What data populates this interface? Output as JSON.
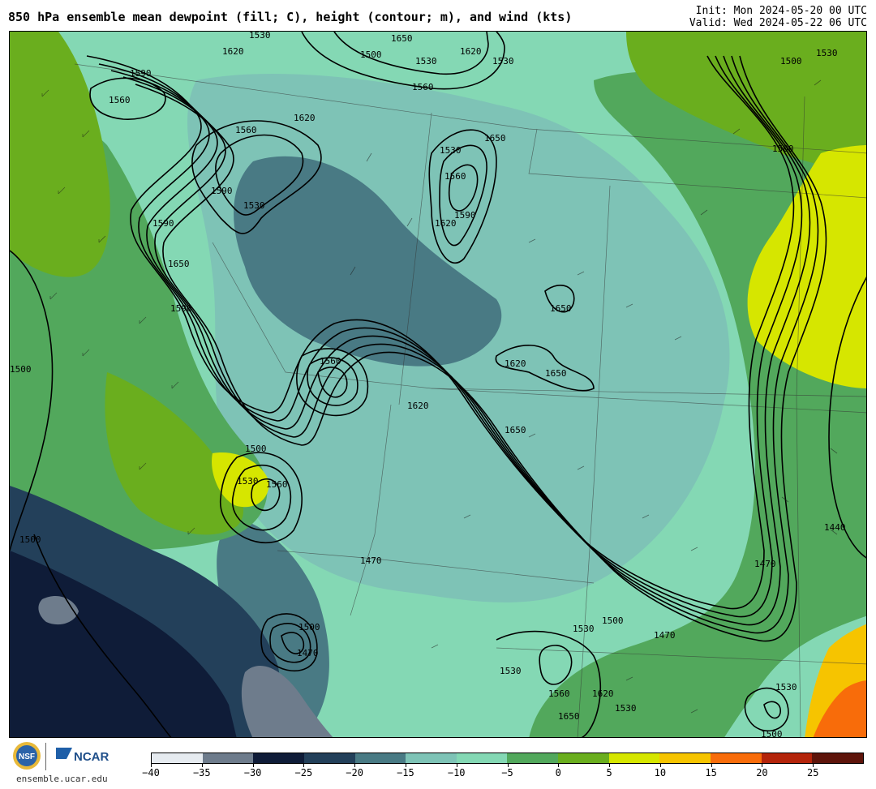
{
  "header": {
    "title": "850 hPa ensemble mean dewpoint (fill; C), height (contour; m), and wind (kts)",
    "init": "Init: Mon 2024-05-20 00 UTC",
    "valid": "Valid: Wed 2024-05-22 06 UTC"
  },
  "footer": {
    "org_logo_text": "NSF",
    "ncar_text": "NCAR",
    "site": "ensemble.ucar.edu"
  },
  "colorbar": {
    "ticks": [
      "-40",
      "-35",
      "-30",
      "-25",
      "-20",
      "-15",
      "-10",
      "-5",
      "0",
      "5",
      "10",
      "15",
      "20",
      "25"
    ],
    "colors": [
      "#e6ebf0",
      "#6e7c8c",
      "#0f1c38",
      "#23405a",
      "#497a84",
      "#7ec3b6",
      "#84d8b4",
      "#52a85c",
      "#6aae1e",
      "#d6e600",
      "#f6c400",
      "#f86c0a",
      "#b4240a",
      "#5e140a"
    ]
  },
  "map": {
    "contour_labels": [
      "1590",
      "1560",
      "1620",
      "1530",
      "1650",
      "1500",
      "1470",
      "1440",
      "1620",
      "1560",
      "1530",
      "1590",
      "1650",
      "1560",
      "1620",
      "1650",
      "1500",
      "1530",
      "1560",
      "1500",
      "1470",
      "1530",
      "1500",
      "1530",
      "1620",
      "1560",
      "1650",
      "1530",
      "1500",
      "1470",
      "1440",
      "1470",
      "1620",
      "1590"
    ]
  }
}
